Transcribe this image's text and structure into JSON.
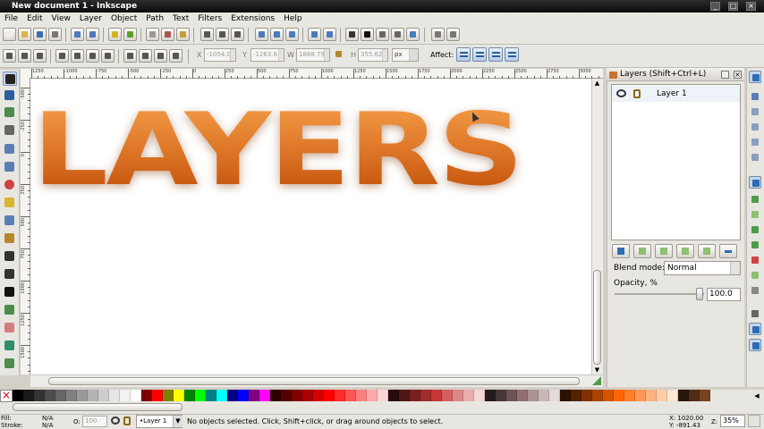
{
  "window": {
    "title": "New document 1 - Inkscape",
    "controls": [
      "_",
      "□",
      "×"
    ]
  },
  "menu": [
    "File",
    "Edit",
    "View",
    "Layer",
    "Object",
    "Path",
    "Text",
    "Filters",
    "Extensions",
    "Help"
  ],
  "select_bar": {
    "x_label": "X",
    "x_value": "-1054.0",
    "y_label": "Y",
    "y_value": "-1263.6",
    "w_label": "W",
    "w_value": "1888.79",
    "h_label": "H",
    "h_value": "355.626",
    "unit": "px",
    "affect_label": "Affect:"
  },
  "ruler": {
    "top_labels": [
      "1250",
      "-1000",
      "-750",
      "-500",
      "-250",
      "0",
      "250",
      "500",
      "750",
      "1000",
      "1250",
      "1500",
      "1750",
      "2000",
      "2250",
      "2500",
      "2750",
      "3000"
    ],
    "left_labels": [
      "-500",
      "-250",
      "0",
      "250",
      "500",
      "750",
      "1000",
      "1250",
      "1500"
    ]
  },
  "canvas": {
    "text": "LAYERS"
  },
  "layers_panel": {
    "title": "Layers (Shift+Ctrl+L)",
    "layers": [
      {
        "name": "Layer 1",
        "visible": true,
        "locked": false
      }
    ],
    "blend_label": "Blend mode:",
    "blend_value": "Normal",
    "opacity_label": "Opacity, %",
    "opacity_value": "100.0",
    "opacity_fraction": 1.0
  },
  "palette": {
    "colors": [
      "#000000",
      "#1a1a1a",
      "#333333",
      "#4d4d4d",
      "#666666",
      "#808080",
      "#999999",
      "#b3b3b3",
      "#cccccc",
      "#e6e6e6",
      "#f2f2f2",
      "#ffffff",
      "#800000",
      "#ff0000",
      "#808000",
      "#ffff00",
      "#008000",
      "#00ff00",
      "#008080",
      "#00ffff",
      "#000080",
      "#0000ff",
      "#800080",
      "#ff00ff",
      "#2b0000",
      "#550000",
      "#800000",
      "#aa0000",
      "#d40000",
      "#ff0000",
      "#ff2a2a",
      "#ff5555",
      "#ff8080",
      "#ffaaaa",
      "#ffd5d5",
      "#280b0b",
      "#501616",
      "#782121",
      "#a02c2c",
      "#c83737",
      "#d35f5f",
      "#de8787",
      "#e9afaf",
      "#f4d7d7",
      "#241c1c",
      "#483737",
      "#6c5353",
      "#916f6f",
      "#ac9393",
      "#c8b7b7",
      "#e3dbdb",
      "#2b1100",
      "#552200",
      "#803300",
      "#aa4400",
      "#d45500",
      "#ff6600",
      "#ff7f2a",
      "#ff9955",
      "#ffb380",
      "#ffccaa",
      "#ffe6d5",
      "#28170b",
      "#502d16",
      "#784421"
    ]
  },
  "status": {
    "fill_label": "Fill:",
    "fill_value": "N/A",
    "stroke_label": "Stroke:",
    "stroke_value": "N/A",
    "o_label": "O:",
    "o_value": "100",
    "current_layer": "•Layer 1",
    "message": "No objects selected. Click, Shift+click, or drag around objects to select.",
    "x_coord": "X: 1020.00",
    "y_coord": "Y: -891.43",
    "z_label": "Z:",
    "zoom": "35%"
  }
}
